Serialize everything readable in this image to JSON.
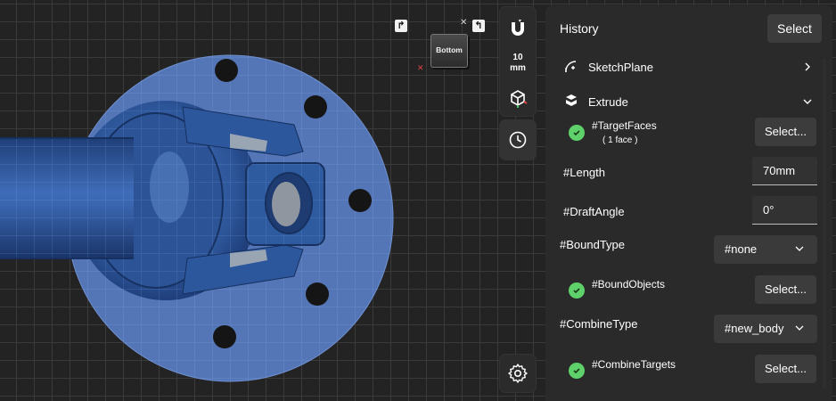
{
  "viewport": {
    "viewcube_label": "Bottom",
    "rotate_left_glyph": "↱",
    "rotate_right_glyph": "↰",
    "axis_x_glyph": "✕",
    "close_glyph": "✕"
  },
  "toolbar": {
    "snap_value": "10",
    "snap_unit": "mm"
  },
  "panel": {
    "title": "History",
    "select_label": "Select",
    "items": [
      {
        "label": "SketchPlane"
      },
      {
        "label": "Extrude"
      }
    ],
    "extrude": {
      "target_faces_label": "#TargetFaces",
      "target_faces_sub": "( 1 face )",
      "target_faces_button": "Select...",
      "length_label": "#Length",
      "length_value": "70mm",
      "draft_angle_label": "#DraftAngle",
      "draft_angle_value": "0°",
      "bound_type_label": "#BoundType",
      "bound_type_value": "#none",
      "bound_objects_label": "#BoundObjects",
      "bound_objects_button": "Select...",
      "combine_type_label": "#CombineType",
      "combine_type_value": "#new_body",
      "combine_targets_label": "#CombineTargets",
      "combine_targets_button": "Select..."
    }
  },
  "colors": {
    "accent_check": "#5fd16a",
    "model_blue": "#2f5a9a",
    "flange_blue": "#5a7fc8"
  }
}
